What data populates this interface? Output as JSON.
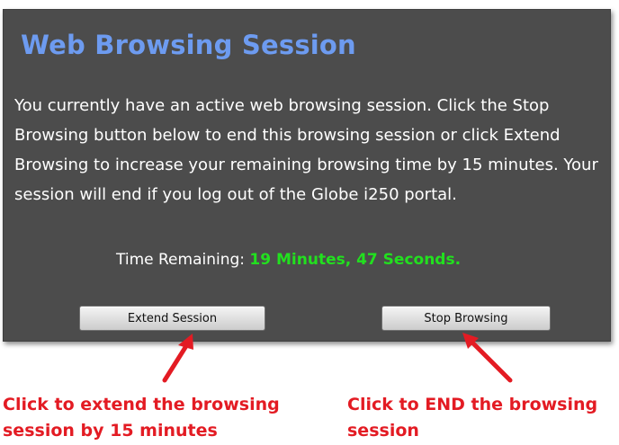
{
  "dialog": {
    "title": "Web Browsing Session",
    "message": "You currently have an active web browsing session. Click the Stop Browsing button below to end this browsing session or click Extend Browsing to increase your remaining browsing time by 15 minutes. Your session will end if you log out of the Globe i250 portal.",
    "time_label": "Time Remaining: ",
    "time_value": "19 Minutes, 47 Seconds.",
    "extend_button_label": "Extend Session",
    "stop_button_label": "Stop Browsing"
  },
  "annotations": {
    "extend_caption": "Click to extend the browsing session by 15 minutes",
    "stop_caption": "Click to END the browsing session"
  },
  "colors": {
    "panel_background": "#4c4c4c",
    "title": "#6d9bf0",
    "time_value": "#22e01f",
    "annotation": "#e31b23"
  },
  "icons": {
    "extend_arrow": "red-arrow-icon",
    "stop_arrow": "red-arrow-icon"
  }
}
